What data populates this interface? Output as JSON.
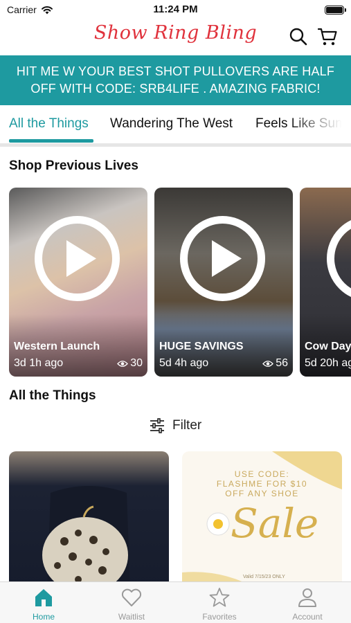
{
  "status_bar": {
    "carrier": "Carrier",
    "time": "11:24 PM"
  },
  "header": {
    "brand": "Show Ring Bling",
    "search_icon": "search-icon",
    "cart_icon": "cart-icon"
  },
  "promo_banner": {
    "text": "HIT ME W YOUR BEST SHOT PULLOVERS ARE HALF OFF WITH CODE: SRB4LIFE . AMAZING FABRIC!"
  },
  "category_tabs": [
    {
      "label": "All the Things",
      "active": true
    },
    {
      "label": "Wandering The West",
      "active": false
    },
    {
      "label": "Feels Like Sum",
      "active": false
    }
  ],
  "previous_lives": {
    "title": "Shop Previous Lives",
    "items": [
      {
        "title": "Western Launch",
        "age": "3d 1h ago",
        "views": "30"
      },
      {
        "title": "HUGE SAVINGS",
        "age": "5d 4h ago",
        "views": "56"
      },
      {
        "title": "Cow Day",
        "age": "5d 20h ago",
        "views": ""
      }
    ]
  },
  "products_section": {
    "title": "All the Things",
    "filter_label": "Filter",
    "promo_card": {
      "line1": "USE CODE:",
      "line2": "FLASHME FOR $10",
      "line3": "OFF ANY SHOE",
      "sale": "Sale",
      "valid": "Valid 7/15/23 ONLY"
    }
  },
  "tabbar": [
    {
      "label": "Home",
      "icon": "home-icon",
      "active": true
    },
    {
      "label": "Waitlist",
      "icon": "heart-icon",
      "active": false
    },
    {
      "label": "Favorites",
      "icon": "star-icon",
      "active": false
    },
    {
      "label": "Account",
      "icon": "person-icon",
      "active": false
    }
  ],
  "colors": {
    "accent": "#1e9aa0",
    "brand": "#e0323c"
  }
}
